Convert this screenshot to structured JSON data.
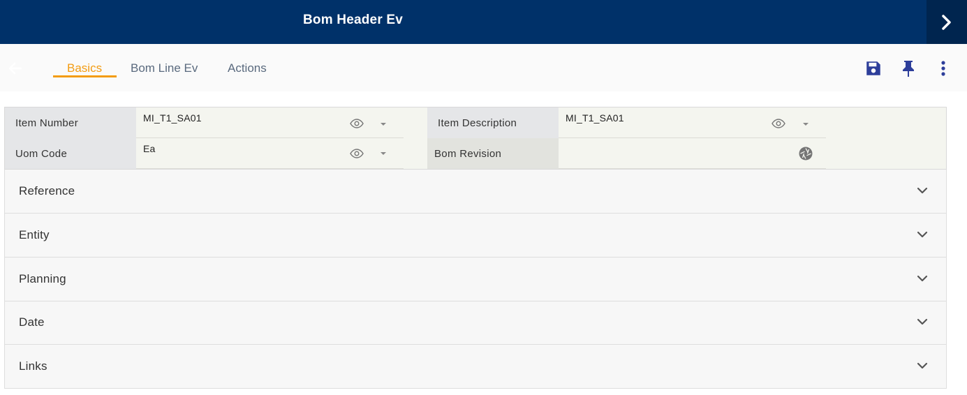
{
  "header": {
    "title": "Bom Header Ev",
    "next_icon": "chevron-right-icon"
  },
  "toolbar": {
    "back_icon": "arrow-left-icon",
    "tabs": [
      {
        "label": "Basics",
        "active": true
      },
      {
        "label": "Bom Line Ev",
        "active": false
      },
      {
        "label": "Actions",
        "active": false
      }
    ],
    "actions": [
      "save-icon",
      "pin-icon",
      "more-vertical-icon"
    ]
  },
  "form": {
    "item_number": {
      "label": "Item Number",
      "value": "MI_T1_SA01"
    },
    "item_description": {
      "label": "Item Description",
      "value": "MI_T1_SA01"
    },
    "uom_code": {
      "label": "Uom Code",
      "value": "Ea"
    },
    "bom_revision": {
      "label": "Bom Revision",
      "value": ""
    }
  },
  "sections": [
    {
      "label": "Reference"
    },
    {
      "label": "Entity"
    },
    {
      "label": "Planning"
    },
    {
      "label": "Date"
    },
    {
      "label": "Links"
    }
  ],
  "colors": {
    "header": "#003169",
    "accent": "#f39c12",
    "icon": "#2d3e9a"
  }
}
